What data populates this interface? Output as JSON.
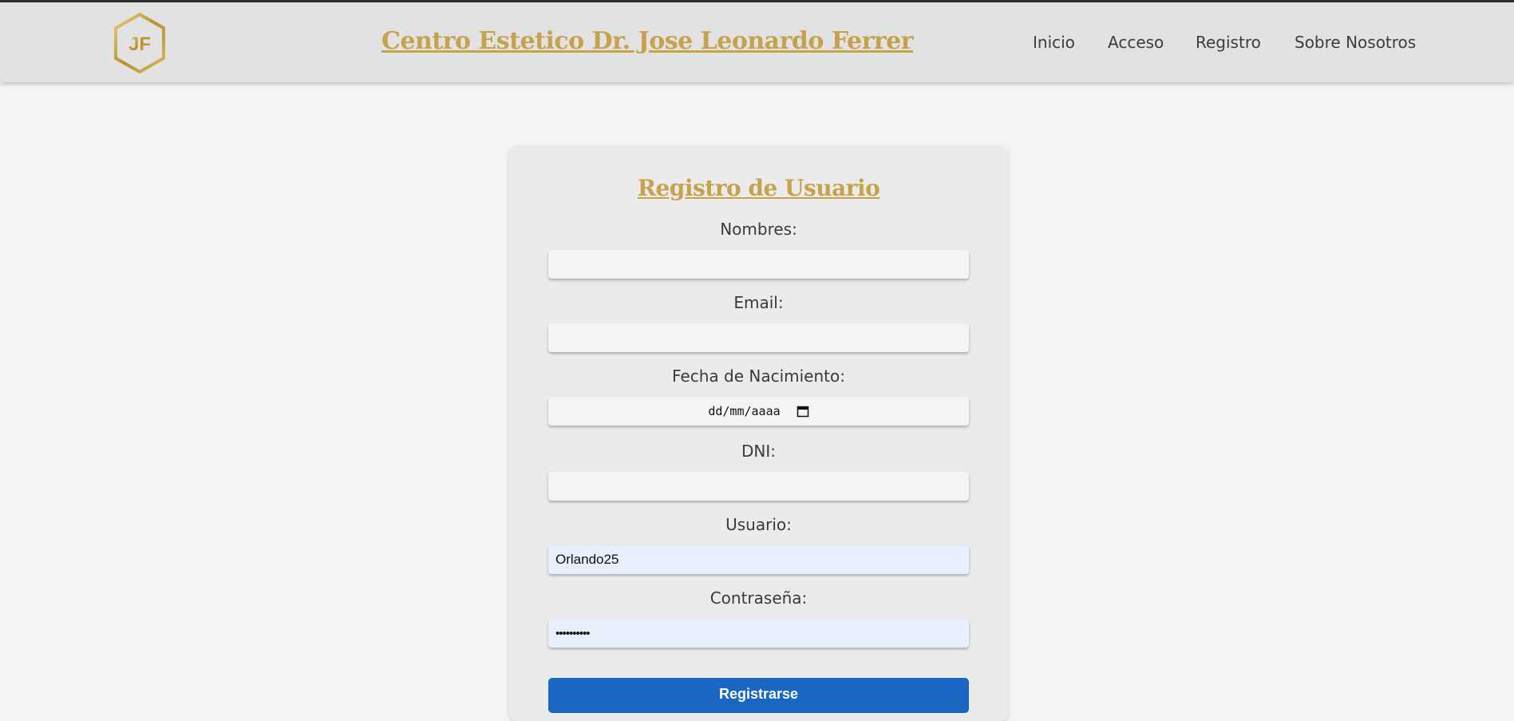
{
  "header": {
    "logo_text": "JF",
    "title": "Centro Estetico Dr. Jose Leonardo Ferrer",
    "nav": [
      {
        "label": "Inicio"
      },
      {
        "label": "Acceso"
      },
      {
        "label": "Registro"
      },
      {
        "label": "Sobre Nosotros"
      }
    ]
  },
  "form": {
    "title": "Registro de Usuario",
    "fields": {
      "nombres": {
        "label": "Nombres:",
        "value": ""
      },
      "email": {
        "label": "Email:",
        "value": ""
      },
      "fecha": {
        "label": "Fecha de Nacimiento:",
        "value": "dd/mm/aaaa"
      },
      "dni": {
        "label": "DNI:",
        "value": ""
      },
      "usuario": {
        "label": "Usuario:",
        "value": "Orlando25"
      },
      "contrasena": {
        "label": "Contraseña:",
        "value": "••••••••••"
      }
    },
    "submit_label": "Registrarse"
  },
  "colors": {
    "gold": "#c5a24b",
    "button_blue": "#1967c2",
    "autofill_bg": "#e8f0fe"
  }
}
